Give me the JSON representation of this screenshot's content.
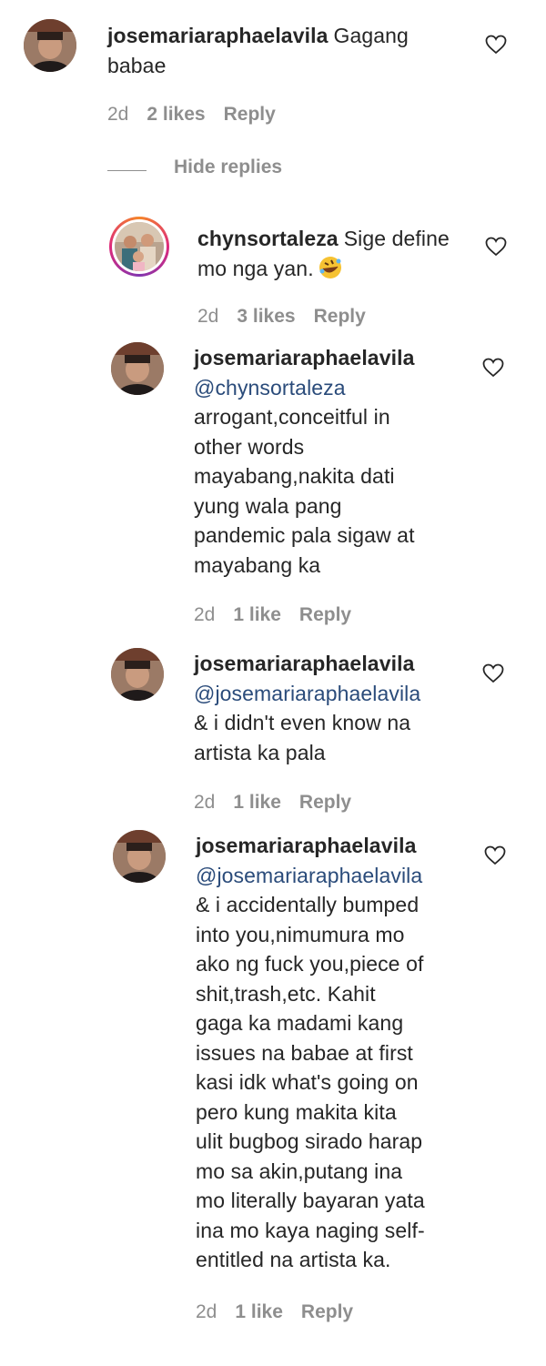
{
  "comments": [
    {
      "username": "josemariaraphaelavila",
      "text": "Gagang babae",
      "time": "2d",
      "likes": "2 likes",
      "reply": "Reply"
    },
    {
      "username": "chynsortaleza",
      "text": "Sige define mo nga yan.",
      "emoji": "rolling-on-floor-laughing-emoji",
      "time": "2d",
      "likes": "3 likes",
      "reply": "Reply"
    },
    {
      "username": "josemariaraphaelavila",
      "mention": "@chynsortaleza",
      "text": "arrogant,conceitful in\nother words\nmayabang,nakita dati\nyung wala pang\npandemic pala sigaw at\nmayabang ka",
      "time": "2d",
      "likes": "1 like",
      "reply": "Reply"
    },
    {
      "username": "josemariaraphaelavila",
      "mention": "@josemariaraphaelavila",
      "text": "& i didn't even know na\nartista ka pala",
      "time": "2d",
      "likes": "1 like",
      "reply": "Reply"
    },
    {
      "username": "josemariaraphaelavila",
      "mention": "@josemariaraphaelavila",
      "text": "& i accidentally bumped\ninto you,nimumura mo\nako ng fuck you,piece of\nshit,trash,etc. Kahit\ngaga ka madami kang\nissues na babae at first\nkasi idk what's going on\npero kung makita kita\nulit bugbog sirado harap\nmo sa akin,putang ina\nmo literally bayaran yata\nina mo kaya naging self-\nentitled na artista ka.",
      "time": "2d",
      "likes": "1 like",
      "reply": "Reply"
    }
  ],
  "hide_replies_label": "Hide replies",
  "icons": {
    "like": "heart-outline-icon"
  },
  "colors": {
    "text": "#262626",
    "muted": "#8e8e8e",
    "mention": "#2a4b7a"
  }
}
